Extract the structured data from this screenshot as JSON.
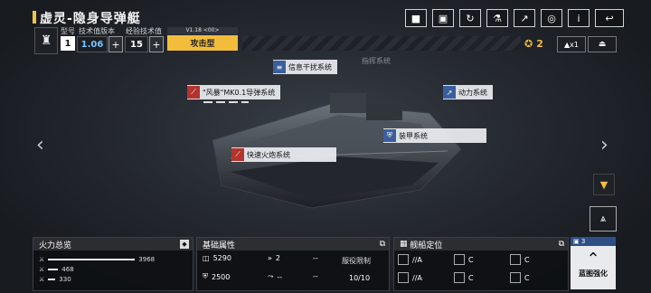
{
  "header": {
    "title": "虚灵-隐身导弹艇"
  },
  "toolbar": {
    "icons": [
      "camera-icon",
      "image-icon",
      "refresh-icon",
      "flask-icon",
      "export-icon",
      "scan-icon",
      "info-icon",
      "back-icon"
    ],
    "glyphs": [
      "■",
      "▣",
      "↻",
      "⚗",
      "↗",
      "◎",
      "i",
      "↩"
    ]
  },
  "ship_info": {
    "labels": {
      "model": "型号",
      "tech_version": "技术值版本",
      "exp_tech": "经验技术值"
    },
    "model_value": "1",
    "tech_value": "1.06",
    "exp_value": "15",
    "version": "V1.18 <00>",
    "type": "攻击型"
  },
  "resources": {
    "currency": "2",
    "fleet_count": "x1"
  },
  "systems": {
    "missile": "\"风暴\"MK0.1导弹系统",
    "jamming": "信息干扰系统",
    "command": "指挥系统",
    "power": "动力系统",
    "armor": "装甲系统",
    "rapid_fire": "快速火炮系统"
  },
  "firepower": {
    "title": "火力总览",
    "values": [
      "3968",
      "468",
      "330"
    ],
    "ratios": [
      1.0,
      0.118,
      0.083
    ]
  },
  "attributes": {
    "title": "基础属性",
    "hp": "5290",
    "armor": "2500",
    "v1": "2",
    "v2": "--",
    "v3": "--",
    "v4": "--",
    "limit_label": "服役限制",
    "limit_value": "10/10"
  },
  "position": {
    "title": "舰船定位",
    "grades": [
      "//A",
      "C",
      "C",
      "//A",
      "C",
      "C"
    ]
  },
  "blueprint": {
    "label": "蓝图强化",
    "count": "3"
  },
  "colors": {
    "accent": "#f3bd3c",
    "missile": "#b3342e",
    "system": "#3b5f9c"
  }
}
